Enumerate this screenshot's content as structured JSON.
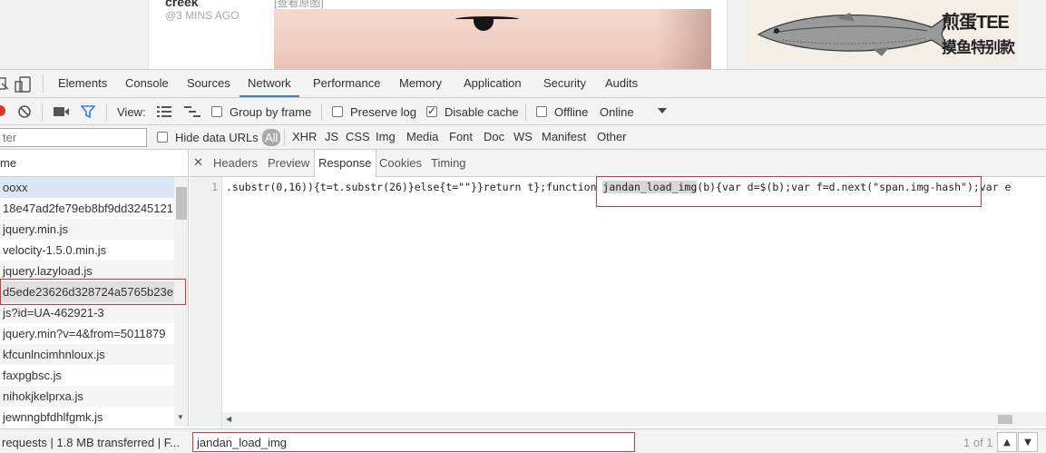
{
  "webpage": {
    "post_author": "creek",
    "post_time": "@3 MINS AGO",
    "post_link": "[查看原图]",
    "ad_title": "煎蛋TEE",
    "ad_subtitle": "摸鱼特别款"
  },
  "devtools": {
    "tabs": [
      "Elements",
      "Console",
      "Sources",
      "Network",
      "Performance",
      "Memory",
      "Application",
      "Security",
      "Audits"
    ],
    "active_tab": "Network",
    "toolbar": {
      "view_label": "View:",
      "group_by_frame": "Group by frame",
      "preserve_log": "Preserve log",
      "disable_cache": "Disable cache",
      "offline": "Offline",
      "throttle": "Online"
    },
    "filter": {
      "placeholder": "ter",
      "hide_data_urls": "Hide data URLs",
      "types": [
        "All",
        "XHR",
        "JS",
        "CSS",
        "Img",
        "Media",
        "Font",
        "Doc",
        "WS",
        "Manifest",
        "Other"
      ]
    },
    "name_header": "me",
    "requests": [
      "ooxx",
      "18e47ad2fe79eb8bf9dd3245121",
      "jquery.min.js",
      "velocity-1.5.0.min.js",
      "jquery.lazyload.js",
      "d5ede23626d328724a5765b23e",
      "js?id=UA-462921-3",
      "jquery.min?v=4&from=5011879",
      "kfcunlncimhnloux.js",
      "faxpgbsc.js",
      "nihokjkelprxa.js",
      "jewnngbfdhlfgmk.js"
    ],
    "detail_tabs": [
      "Headers",
      "Preview",
      "Response",
      "Cookies",
      "Timing"
    ],
    "active_detail_tab": "Response",
    "close_glyph": "✕",
    "code": {
      "line_number": "1",
      "before": ".substr(0,16)){t=t.substr(26)}else{t=\"\"}}return t};function ",
      "highlight": "jandan_load_img",
      "after": "(b){var d=$(b);var f=d.next(\"span.img-hash\");var e"
    },
    "status": "requests | 1.8 MB transferred | F...",
    "search": {
      "value": "jandan_load_img",
      "count": "1 of 1",
      "prev_glyph": "▲",
      "next_glyph": "▼"
    }
  }
}
